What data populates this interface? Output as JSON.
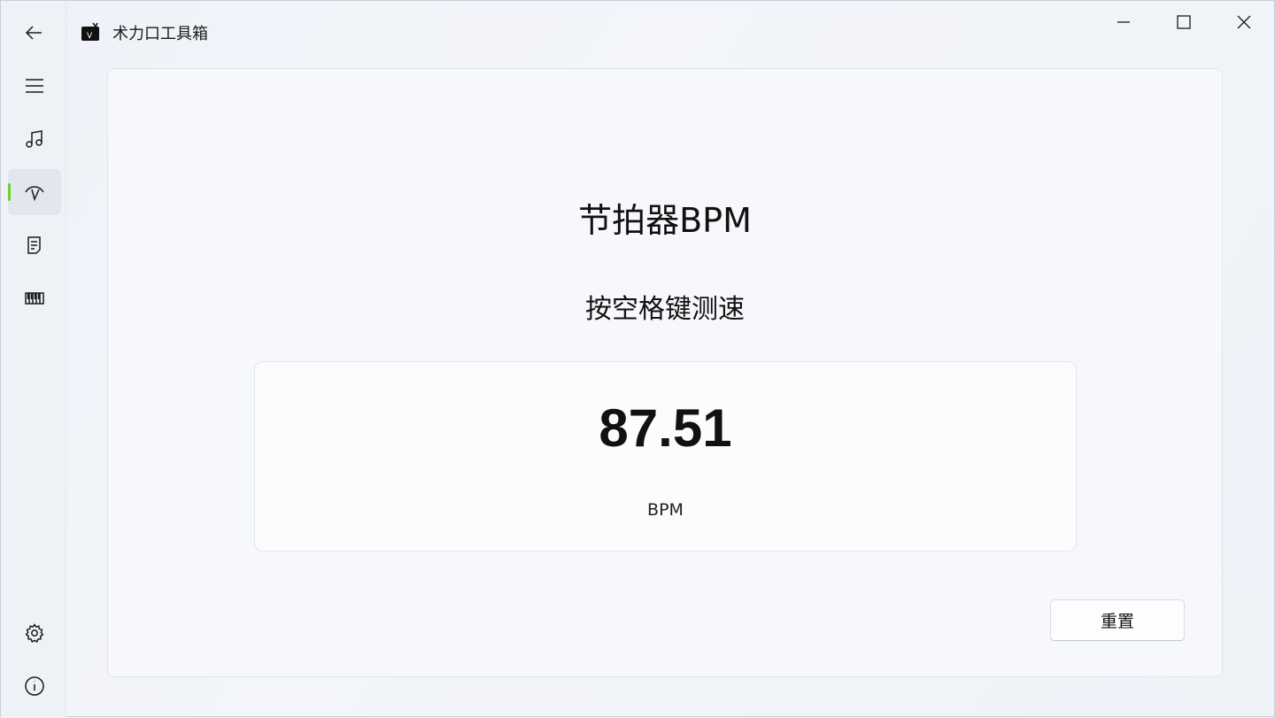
{
  "app": {
    "title": "术力口工具箱",
    "logo_icon": "app-logo-icon"
  },
  "left_rail": {
    "top_items": [
      {
        "name": "back",
        "icon": "arrow-left-icon"
      },
      {
        "name": "menu",
        "icon": "hamburger-icon"
      },
      {
        "name": "music",
        "icon": "music-note-icon"
      },
      {
        "name": "metronome",
        "icon": "metronome-icon",
        "active": true
      },
      {
        "name": "notes",
        "icon": "document-icon"
      },
      {
        "name": "piano",
        "icon": "piano-icon"
      }
    ],
    "bottom_items": [
      {
        "name": "settings",
        "icon": "gear-icon"
      },
      {
        "name": "about",
        "icon": "info-icon"
      }
    ],
    "active_indicator_color": "#6fcf2f"
  },
  "window_controls": [
    "minimize",
    "maximize",
    "close"
  ],
  "main": {
    "title": "节拍器BPM",
    "subtitle": "按空格键测速",
    "bpm_value": "87.51",
    "bpm_unit": "BPM",
    "reset_label": "重置"
  }
}
